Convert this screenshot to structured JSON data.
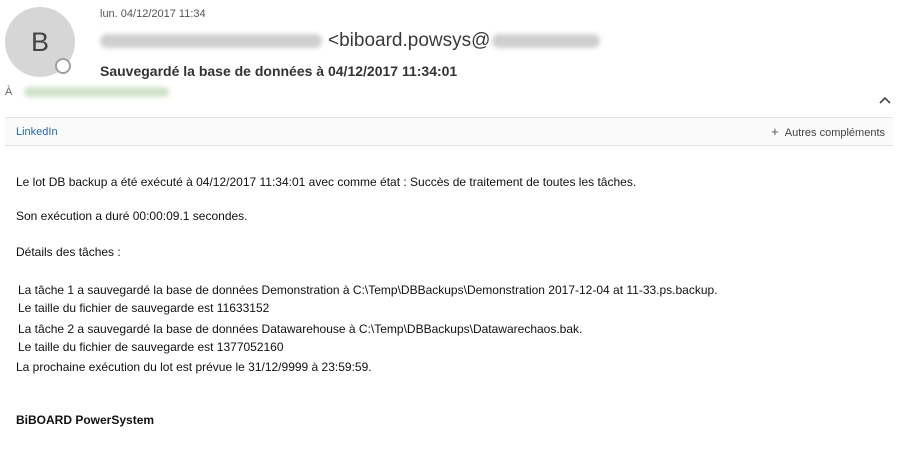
{
  "sender": {
    "avatar_initial": "B",
    "date": "lun. 04/12/2017 11:34",
    "from_visible": "<biboard.powsys@"
  },
  "subject": "Sauvegardé la base de données à 04/12/2017 11:34:01",
  "recipient": {
    "label": "À"
  },
  "addins": {
    "linkedin_label": "LinkedIn",
    "more_label": "Autres compléments"
  },
  "body": {
    "line1": "Le lot DB backup a été exécuté à 04/12/2017 11:34:01 avec comme état : Succès de traitement de toutes les tâches.",
    "line2": "Son exécution a duré 00:00:09.1 secondes.",
    "line3": "Détails des tâches :",
    "tasks": [
      {
        "text": "La tâche 1 a sauvegardé la base de données Demonstration à C:\\Temp\\DBBackups\\Demonstration 2017-12-04 at 11-33.ps.backup.",
        "size": "Le taille du fichier de sauvegarde est 11633152"
      },
      {
        "text": "La tâche 2 a sauvegardé la base de données Datawarehouse à C:\\Temp\\DBBackups\\Datawarechaos.bak.",
        "size": "Le taille du fichier de sauvegarde est 1377052160"
      }
    ],
    "next_run": "La prochaine exécution du lot est prévue le 31/12/9999 à 23:59:59.",
    "signature": "BiBOARD PowerSystem"
  }
}
